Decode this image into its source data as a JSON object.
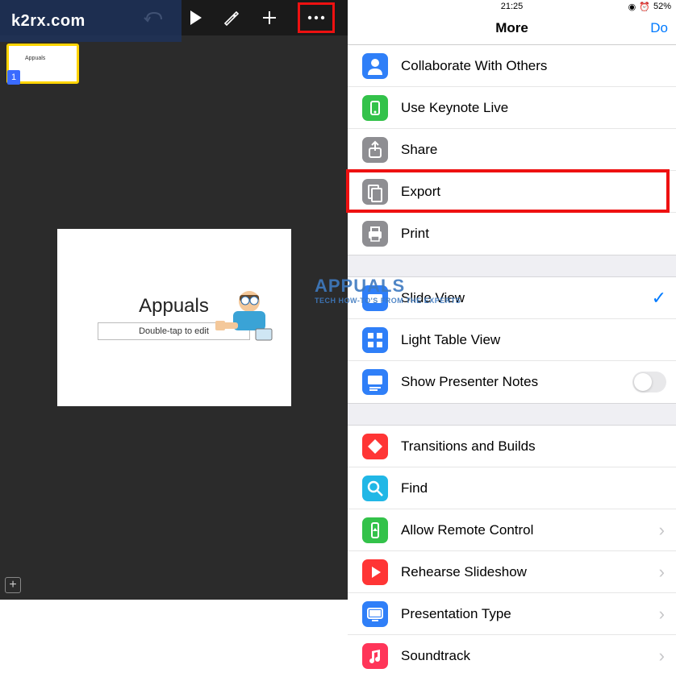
{
  "watermark": "k2rx.com",
  "center_watermark": {
    "line1": "APPUALS",
    "line2": "TECH HOW-TO'S FROM THE EXPERTS"
  },
  "status": {
    "time": "21:25",
    "battery": "52%"
  },
  "panel": {
    "title": "More",
    "done": "Do"
  },
  "editor": {
    "slide_number": "1",
    "thumb_label": "Appuals",
    "slide_title": "Appuals",
    "slide_subtitle": "Double-tap to edit"
  },
  "menu": {
    "group1": [
      {
        "key": "collaborate",
        "label": "Collaborate With Others",
        "icon": "person",
        "color": "#2f7ff8"
      },
      {
        "key": "keynote_live",
        "label": "Use Keynote Live",
        "icon": "broadcast",
        "color": "#33c24a"
      },
      {
        "key": "share",
        "label": "Share",
        "icon": "share",
        "color": "#8e8e92"
      },
      {
        "key": "export",
        "label": "Export",
        "icon": "export",
        "color": "#8e8e92",
        "highlight": true
      },
      {
        "key": "print",
        "label": "Print",
        "icon": "print",
        "color": "#8e8e92"
      }
    ],
    "group2": [
      {
        "key": "slide_view",
        "label": "Slide View",
        "icon": "slide",
        "color": "#2f7ff8",
        "checked": true
      },
      {
        "key": "light_table",
        "label": "Light Table View",
        "icon": "grid",
        "color": "#2f7ff8"
      },
      {
        "key": "presenter_notes",
        "label": "Show Presenter Notes",
        "icon": "notes",
        "color": "#2f7ff8",
        "toggle": true
      }
    ],
    "group3": [
      {
        "key": "transitions",
        "label": "Transitions and Builds",
        "icon": "diamond",
        "color": "#ff3535"
      },
      {
        "key": "find",
        "label": "Find",
        "icon": "search",
        "color": "#21b7e6"
      },
      {
        "key": "remote",
        "label": "Allow Remote Control",
        "icon": "remote",
        "color": "#33c24a",
        "disclosure": true
      },
      {
        "key": "rehearse",
        "label": "Rehearse Slideshow",
        "icon": "play",
        "color": "#ff3535",
        "disclosure": true
      },
      {
        "key": "pres_type",
        "label": "Presentation Type",
        "icon": "screen",
        "color": "#2f7ff8",
        "disclosure": true
      },
      {
        "key": "soundtrack",
        "label": "Soundtrack",
        "icon": "music",
        "color": "#ff3559",
        "disclosure": true
      }
    ]
  }
}
